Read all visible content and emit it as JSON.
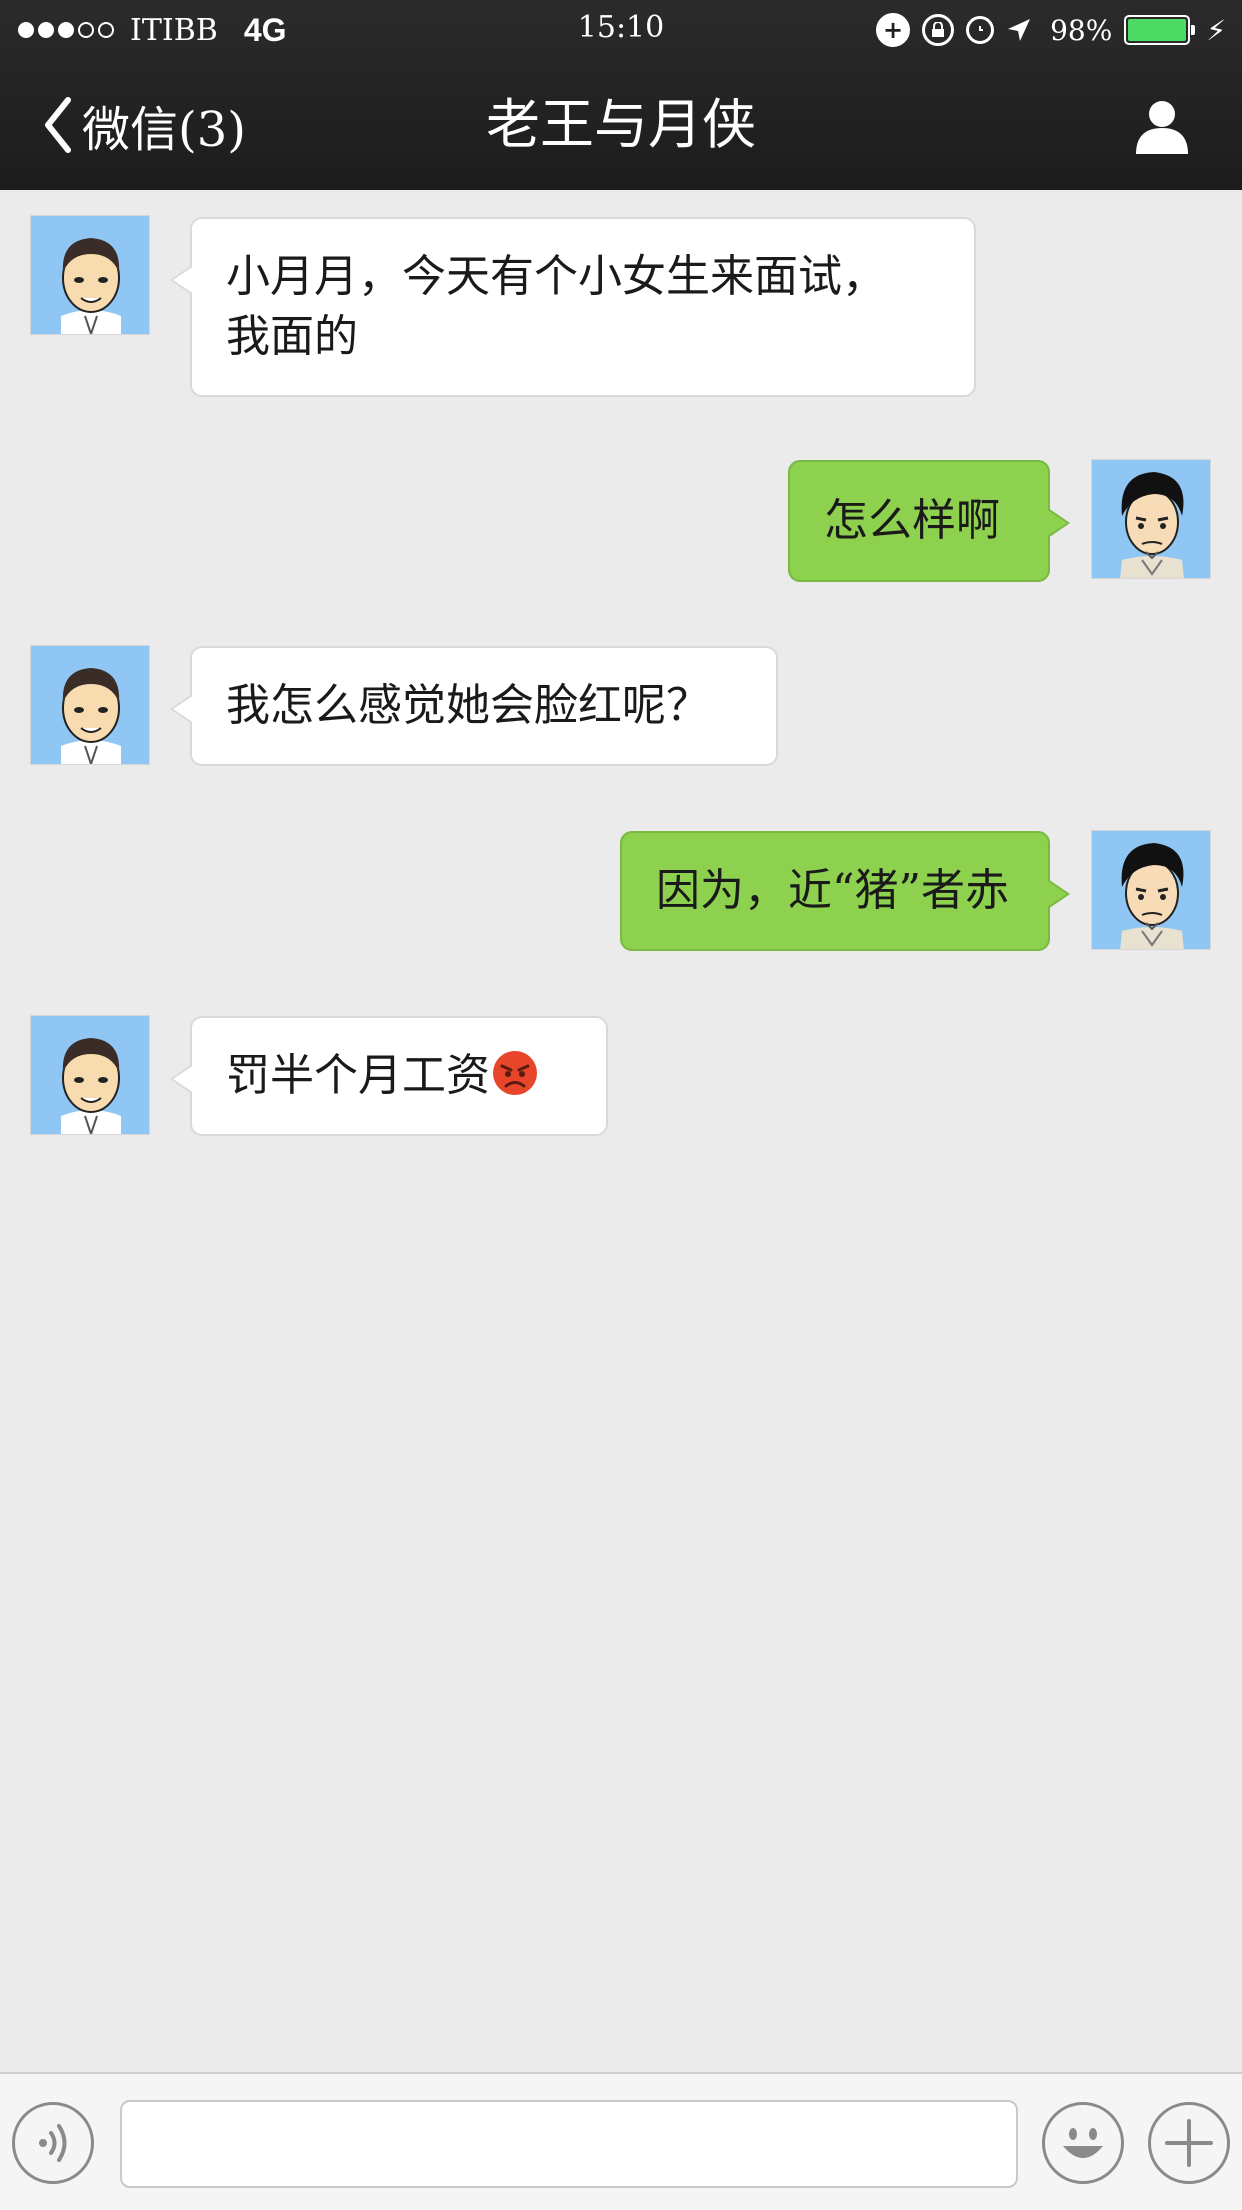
{
  "status_bar": {
    "carrier": "ITIBB",
    "network": "4G",
    "time": "15:10",
    "battery": "98%",
    "battery_level": 0.98,
    "signal_bars": 3,
    "signal_max": 5,
    "icons": [
      "signal-dots-icon",
      "add-circle-icon",
      "rotation-lock-icon",
      "alarm-icon",
      "location-arrow-icon",
      "battery-icon",
      "charging-bolt-icon"
    ]
  },
  "nav": {
    "back_label": "微信(3)",
    "title": "老王与月侠",
    "right_icon": "person-icon"
  },
  "messages": [
    {
      "side": "in",
      "sender_avatar": "laowang-avatar",
      "lines": [
        "小月月，今天有个小女生来面试，",
        "我面的"
      ]
    },
    {
      "side": "out",
      "sender_avatar": "yuexia-avatar",
      "text": "怎么样啊"
    },
    {
      "side": "in",
      "sender_avatar": "laowang-avatar",
      "text": "我怎么感觉她会脸红呢？"
    },
    {
      "side": "out",
      "sender_avatar": "yuexia-avatar",
      "text": "因为，近“猪”者赤"
    },
    {
      "side": "in",
      "sender_avatar": "laowang-avatar",
      "text": "罚半个月工资",
      "emoji": "angry-face-emoji"
    }
  ],
  "input_bar": {
    "input_value": "",
    "placeholder": "",
    "icons": [
      "voice-icon",
      "emoji-smiley-icon",
      "plus-icon"
    ]
  },
  "colors": {
    "navbar_bg": "#1f1f1f",
    "chat_bg": "#ebebeb",
    "incoming_bubble": "#ffffff",
    "outgoing_bubble": "#8dd14f",
    "avatar_bg": "#8fc6f4",
    "battery_fill": "#4cd964"
  }
}
